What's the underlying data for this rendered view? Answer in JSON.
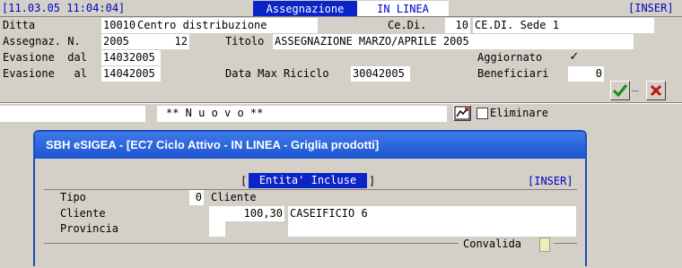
{
  "topbar": {
    "datetime": "[11.03.05 11:04:04]",
    "mode_label": "Assegnazione",
    "status": "IN LINEA",
    "insert_mode": "[INSER]"
  },
  "form": {
    "ditta_label": "Ditta",
    "ditta_code": "10010",
    "ditta_name": "Centro distribuzione",
    "cedi_label": "Ce.Di.",
    "cedi_code": "10",
    "cedi_name": "CE.DI. Sede 1",
    "assegnaz_label": "Assegnaz. N.",
    "assegnaz_year": "2005",
    "assegnaz_num": "12",
    "titolo_label": "Titolo",
    "titolo_value": "ASSEGNAZIONE MARZO/APRILE 2005",
    "evasione_dal_label": "Evasione  dal",
    "evasione_dal_value": "14032005",
    "aggiornato_label": "Aggiornato",
    "aggiornato_check": "✓",
    "evasione_al_label": "Evasione   al",
    "evasione_al_value": "14042005",
    "data_max_label": "Data Max Riciclo",
    "data_max_value": "30042005",
    "beneficiari_label": "Beneficiari",
    "beneficiari_value": "0",
    "confirm_icon": "check-icon",
    "cancel_icon": "x-icon"
  },
  "searchbar": {
    "search_value": "",
    "nuovo_text": "** N u o v o **",
    "eliminare_label": "Eliminare"
  },
  "dialog": {
    "title": "SBH eSIGEA - [EC7 Ciclo Attivo - IN LINEA - Griglia prodotti]",
    "bracket_open": "[",
    "section_tab": "Entita' Incluse",
    "bracket_close": "]",
    "insert_mode": "[INSER]",
    "tipo_label": "Tipo",
    "tipo_value": "0",
    "tipo_desc": "Cliente",
    "cliente_label": "Cliente",
    "cliente_code": "100,30",
    "cliente_name": "CASEIFICIO 6",
    "provincia_label": "Provincia",
    "provincia_code": "",
    "provincia_name": "",
    "convalida_label": "Convalida"
  },
  "colors": {
    "accent_blue": "#0a24c8",
    "dialog_title": "#1c54d2",
    "confirm_green": "#1a8a1a",
    "cancel_red": "#c81010"
  }
}
